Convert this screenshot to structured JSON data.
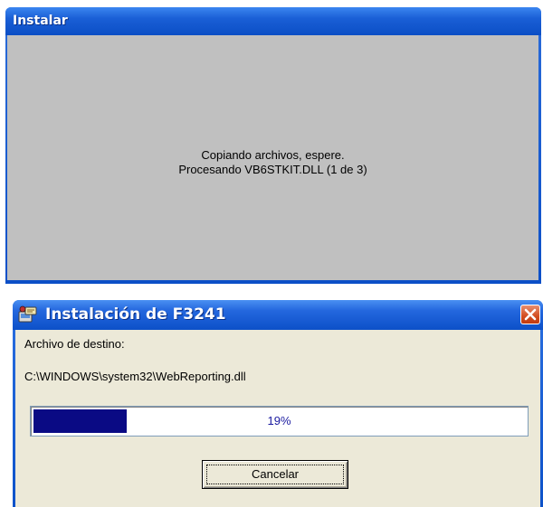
{
  "install_window": {
    "title": "Instalar",
    "message_line1": "Copiando archivos, espere.",
    "message_line2": "Procesando VB6STKIT.DLL (1 de 3)"
  },
  "setup_window": {
    "title": "Instalación de F3241",
    "icon": "setup-app-icon",
    "close_icon": "close-icon",
    "destination_label": "Archivo de destino:",
    "destination_path": "C:\\WINDOWS\\system32\\WebReporting.dll",
    "progress_value": 0.19,
    "progress_text": "19%",
    "cancel_label": "Cancelar"
  },
  "colors": {
    "titlebar_blue": "#0b4ec5",
    "dialog_gray": "#c0c0c0",
    "xp_face": "#ece9d8",
    "progress_fill": "#0a0a84",
    "close_red": "#d24d1f"
  }
}
